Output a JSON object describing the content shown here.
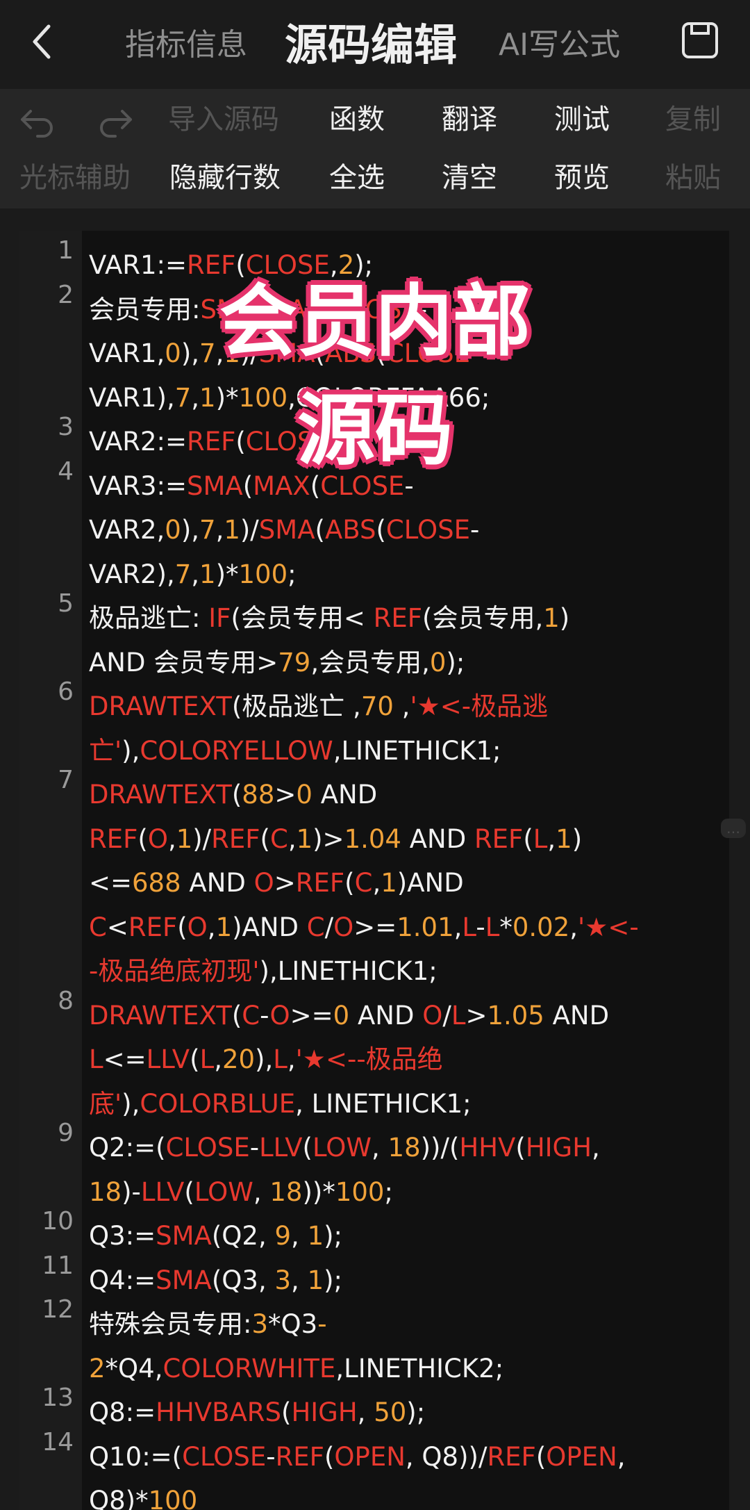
{
  "header": {
    "tabs": [
      {
        "label": "指标信息"
      },
      {
        "label": "源码编辑"
      },
      {
        "label": "AI写公式"
      }
    ]
  },
  "toolbar": {
    "row1": [
      "导入源码",
      "函数",
      "翻译",
      "测试",
      "复制"
    ],
    "row2": [
      "光标辅助",
      "隐藏行数",
      "全选",
      "清空",
      "预览",
      "粘贴"
    ]
  },
  "overlay": {
    "line1": "会员内部",
    "line2": "源码"
  },
  "watermark": "…",
  "code": {
    "line_numbers": [
      "1",
      "2",
      "3",
      "4",
      "5",
      "6",
      "7",
      "8",
      "9",
      "10",
      "11",
      "12",
      "13",
      "14"
    ],
    "lines": [
      [
        [
          "t",
          "VAR1:="
        ],
        [
          "k",
          "REF"
        ],
        [
          "t",
          "("
        ],
        [
          "k",
          "CLOSE"
        ],
        [
          "t",
          ","
        ],
        [
          "n",
          "2"
        ],
        [
          "t",
          ");"
        ]
      ],
      [
        [
          "t",
          "会员专用:"
        ],
        [
          "k",
          "SMA"
        ],
        [
          "t",
          "("
        ],
        [
          "k",
          "MAX"
        ],
        [
          "t",
          "("
        ],
        [
          "k",
          "CLOSE"
        ],
        [
          "t",
          "-"
        ]
      ],
      [
        [
          "t",
          "VAR1,"
        ],
        [
          "n",
          "0"
        ],
        [
          "t",
          "),"
        ],
        [
          "n",
          "7"
        ],
        [
          "t",
          ","
        ],
        [
          "n",
          "1"
        ],
        [
          "t",
          ")/"
        ],
        [
          "k",
          "SMA"
        ],
        [
          "t",
          "("
        ],
        [
          "k",
          "ABS"
        ],
        [
          "t",
          "("
        ],
        [
          "k",
          "CLOSE"
        ],
        [
          "t",
          "-"
        ]
      ],
      [
        [
          "t",
          "VAR1),"
        ],
        [
          "n",
          "7"
        ],
        [
          "t",
          ","
        ],
        [
          "n",
          "1"
        ],
        [
          "t",
          ")*"
        ],
        [
          "n",
          "100"
        ],
        [
          "t",
          ",COLORFFAA66;"
        ]
      ],
      [
        [
          "t",
          "VAR2:="
        ],
        [
          "k",
          "REF"
        ],
        [
          "t",
          "("
        ],
        [
          "k",
          "CLOSE"
        ],
        [
          "t",
          ","
        ],
        [
          "n",
          "1"
        ],
        [
          "t",
          ");"
        ]
      ],
      [
        [
          "t",
          "VAR3:="
        ],
        [
          "k",
          "SMA"
        ],
        [
          "t",
          "("
        ],
        [
          "k",
          "MAX"
        ],
        [
          "t",
          "("
        ],
        [
          "k",
          "CLOSE"
        ],
        [
          "t",
          "-"
        ]
      ],
      [
        [
          "t",
          "VAR2,"
        ],
        [
          "n",
          "0"
        ],
        [
          "t",
          "),"
        ],
        [
          "n",
          "7"
        ],
        [
          "t",
          ","
        ],
        [
          "n",
          "1"
        ],
        [
          "t",
          ")/"
        ],
        [
          "k",
          "SMA"
        ],
        [
          "t",
          "("
        ],
        [
          "k",
          "ABS"
        ],
        [
          "t",
          "("
        ],
        [
          "k",
          "CLOSE"
        ],
        [
          "t",
          "-"
        ]
      ],
      [
        [
          "t",
          "VAR2),"
        ],
        [
          "n",
          "7"
        ],
        [
          "t",
          ","
        ],
        [
          "n",
          "1"
        ],
        [
          "t",
          ")*"
        ],
        [
          "n",
          "100"
        ],
        [
          "t",
          ";"
        ]
      ],
      [
        [
          "t",
          "极品逃亡: "
        ],
        [
          "k",
          "IF"
        ],
        [
          "t",
          "(会员专用< "
        ],
        [
          "k",
          "REF"
        ],
        [
          "t",
          "(会员专用,"
        ],
        [
          "n",
          "1"
        ],
        [
          "t",
          ")"
        ]
      ],
      [
        [
          "t",
          "AND 会员专用>"
        ],
        [
          "n",
          "79"
        ],
        [
          "t",
          ",会员专用,"
        ],
        [
          "n",
          "0"
        ],
        [
          "t",
          ");"
        ]
      ],
      [
        [
          "k",
          "DRAWTEXT"
        ],
        [
          "t",
          "(极品逃亡 ,"
        ],
        [
          "n",
          "70"
        ],
        [
          "t",
          " ,"
        ],
        [
          "s",
          "'★<-极品逃"
        ]
      ],
      [
        [
          "s",
          "亡'"
        ],
        [
          "t",
          "),"
        ],
        [
          "k",
          "COLORYELLOW"
        ],
        [
          "t",
          ",LINETHICK1;"
        ]
      ],
      [
        [
          "k",
          "DRAWTEXT"
        ],
        [
          "t",
          "("
        ],
        [
          "n",
          "88"
        ],
        [
          "t",
          ">"
        ],
        [
          "n",
          "0"
        ],
        [
          "t",
          " AND"
        ]
      ],
      [
        [
          "k",
          "REF"
        ],
        [
          "t",
          "("
        ],
        [
          "k",
          "O"
        ],
        [
          "t",
          ","
        ],
        [
          "n",
          "1"
        ],
        [
          "t",
          ")/"
        ],
        [
          "k",
          "REF"
        ],
        [
          "t",
          "("
        ],
        [
          "k",
          "C"
        ],
        [
          "t",
          ","
        ],
        [
          "n",
          "1"
        ],
        [
          "t",
          ")>"
        ],
        [
          "n",
          "1.04"
        ],
        [
          "t",
          " AND "
        ],
        [
          "k",
          "REF"
        ],
        [
          "t",
          "("
        ],
        [
          "k",
          "L"
        ],
        [
          "t",
          ","
        ],
        [
          "n",
          "1"
        ],
        [
          "t",
          ")"
        ]
      ],
      [
        [
          "t",
          "<="
        ],
        [
          "n",
          "688"
        ],
        [
          "t",
          " AND "
        ],
        [
          "k",
          "O"
        ],
        [
          "t",
          ">"
        ],
        [
          "k",
          "REF"
        ],
        [
          "t",
          "("
        ],
        [
          "k",
          "C"
        ],
        [
          "t",
          ","
        ],
        [
          "n",
          "1"
        ],
        [
          "t",
          ")AND"
        ]
      ],
      [
        [
          "k",
          "C"
        ],
        [
          "t",
          "<"
        ],
        [
          "k",
          "REF"
        ],
        [
          "t",
          "("
        ],
        [
          "k",
          "O"
        ],
        [
          "t",
          ","
        ],
        [
          "n",
          "1"
        ],
        [
          "t",
          ")AND "
        ],
        [
          "k",
          "C"
        ],
        [
          "t",
          "/"
        ],
        [
          "k",
          "O"
        ],
        [
          "t",
          ">="
        ],
        [
          "n",
          "1.01"
        ],
        [
          "t",
          ","
        ],
        [
          "k",
          "L"
        ],
        [
          "t",
          "-"
        ],
        [
          "k",
          "L"
        ],
        [
          "t",
          "*"
        ],
        [
          "n",
          "0.02"
        ],
        [
          "t",
          ","
        ],
        [
          "s",
          "'★<-"
        ]
      ],
      [
        [
          "s",
          "-极品绝底初现'"
        ],
        [
          "t",
          "),LINETHICK1;"
        ]
      ],
      [
        [
          "k",
          "DRAWTEXT"
        ],
        [
          "t",
          "("
        ],
        [
          "k",
          "C"
        ],
        [
          "t",
          "-"
        ],
        [
          "k",
          "O"
        ],
        [
          "t",
          ">="
        ],
        [
          "n",
          "0"
        ],
        [
          "t",
          " AND "
        ],
        [
          "k",
          "O"
        ],
        [
          "t",
          "/"
        ],
        [
          "k",
          "L"
        ],
        [
          "t",
          ">"
        ],
        [
          "n",
          "1.05"
        ],
        [
          "t",
          " AND"
        ]
      ],
      [
        [
          "k",
          "L"
        ],
        [
          "t",
          "<="
        ],
        [
          "k",
          "LLV"
        ],
        [
          "t",
          "("
        ],
        [
          "k",
          "L"
        ],
        [
          "t",
          ","
        ],
        [
          "n",
          "20"
        ],
        [
          "t",
          "),"
        ],
        [
          "k",
          "L"
        ],
        [
          "t",
          ","
        ],
        [
          "s",
          "'★<--极品绝"
        ]
      ],
      [
        [
          "s",
          "底'"
        ],
        [
          "t",
          "),"
        ],
        [
          "k",
          "COLORBLUE"
        ],
        [
          "t",
          ", LINETHICK1;"
        ]
      ],
      [
        [
          "t",
          "Q2:=("
        ],
        [
          "k",
          "CLOSE"
        ],
        [
          "t",
          "-"
        ],
        [
          "k",
          "LLV"
        ],
        [
          "t",
          "("
        ],
        [
          "k",
          "LOW"
        ],
        [
          "t",
          ", "
        ],
        [
          "n",
          "18"
        ],
        [
          "t",
          "))/("
        ],
        [
          "k",
          "HHV"
        ],
        [
          "t",
          "("
        ],
        [
          "k",
          "HIGH"
        ],
        [
          "t",
          ","
        ]
      ],
      [
        [
          "n",
          "18"
        ],
        [
          "t",
          ")-"
        ],
        [
          "k",
          "LLV"
        ],
        [
          "t",
          "("
        ],
        [
          "k",
          "LOW"
        ],
        [
          "t",
          ", "
        ],
        [
          "n",
          "18"
        ],
        [
          "t",
          "))*"
        ],
        [
          "n",
          "100"
        ],
        [
          "t",
          ";"
        ]
      ],
      [
        [
          "t",
          "Q3:="
        ],
        [
          "k",
          "SMA"
        ],
        [
          "t",
          "(Q2, "
        ],
        [
          "n",
          "9"
        ],
        [
          "t",
          ", "
        ],
        [
          "n",
          "1"
        ],
        [
          "t",
          ");"
        ]
      ],
      [
        [
          "t",
          "Q4:="
        ],
        [
          "k",
          "SMA"
        ],
        [
          "t",
          "(Q3, "
        ],
        [
          "n",
          "3"
        ],
        [
          "t",
          ", "
        ],
        [
          "n",
          "1"
        ],
        [
          "t",
          ");"
        ]
      ],
      [
        [
          "t",
          "特殊会员专用:"
        ],
        [
          "n",
          "3"
        ],
        [
          "t",
          "*Q3"
        ],
        [
          "n",
          "-"
        ]
      ],
      [
        [
          "n",
          "2"
        ],
        [
          "t",
          "*Q4,"
        ],
        [
          "k",
          "COLORWHITE"
        ],
        [
          "t",
          ",LINETHICK2;"
        ]
      ],
      [
        [
          "t",
          "Q8:="
        ],
        [
          "k",
          "HHVBARS"
        ],
        [
          "t",
          "("
        ],
        [
          "k",
          "HIGH"
        ],
        [
          "t",
          ", "
        ],
        [
          "n",
          "50"
        ],
        [
          "t",
          ");"
        ]
      ],
      [
        [
          "t",
          "Q10:=("
        ],
        [
          "k",
          "CLOSE"
        ],
        [
          "t",
          "-"
        ],
        [
          "k",
          "REF"
        ],
        [
          "t",
          "("
        ],
        [
          "k",
          "OPEN"
        ],
        [
          "t",
          ", Q8))/"
        ],
        [
          "k",
          "REF"
        ],
        [
          "t",
          "("
        ],
        [
          "k",
          "OPEN"
        ],
        [
          "t",
          ","
        ]
      ],
      [
        [
          "t",
          "Q8)*"
        ],
        [
          "n",
          "100"
        ]
      ]
    ],
    "line_number_rows": [
      0,
      1,
      4,
      5,
      8,
      10,
      12,
      17,
      20,
      22,
      23,
      24,
      26,
      27
    ]
  },
  "colors": {
    "background": "#1b1b1b",
    "toolbar": "#262626",
    "editor": "#111111",
    "keyword": "#e8392f",
    "number": "#f0a23a",
    "text": "#f2f2f2",
    "overlay_stroke": "#e5336b"
  }
}
